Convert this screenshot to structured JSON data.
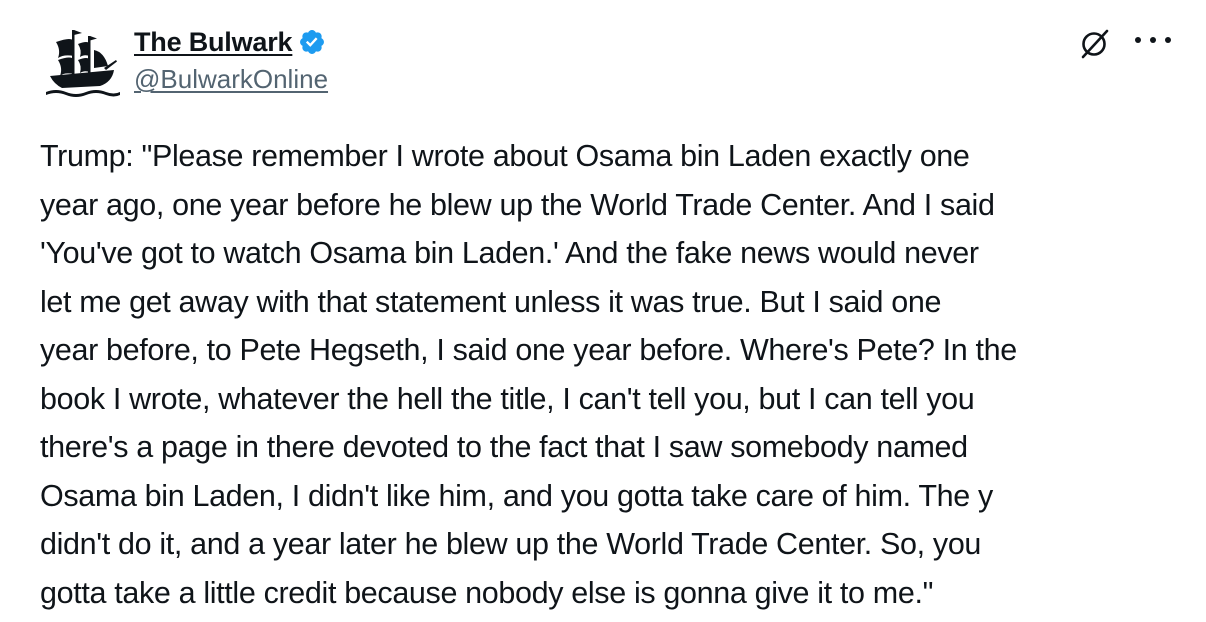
{
  "author": {
    "display_name": "The Bulwark",
    "handle": "@BulwarkOnline",
    "verified": true,
    "verified_color": "#1d9bf0",
    "avatar_icon": "ship-logo-icon"
  },
  "actions": {
    "grok_icon": "grok-icon",
    "more_icon": "more-options-icon"
  },
  "tweet": {
    "text": "Trump: \"Please remember I wrote about Osama bin Laden exactly one\nyear ago, one year before he blew up the World Trade Center. And I said\n'You've got to watch Osama bin Laden.' And the fake news would never\nlet me get away with that statement unless it was true. But I said one\nyear before, to Pete Hegseth, I said one year before. Where's Pete? In the\nbook I wrote, whatever the hell the title, I can't tell you, but I can tell you\nthere's a page in there devoted to the fact that I saw somebody named\nOsama bin Laden, I didn't like him, and you gotta take care of him. The y\ndidn't do it, and a year later he blew up the World Trade Center. So, you\ngotta take a little credit because nobody else is gonna give it to me.\""
  }
}
